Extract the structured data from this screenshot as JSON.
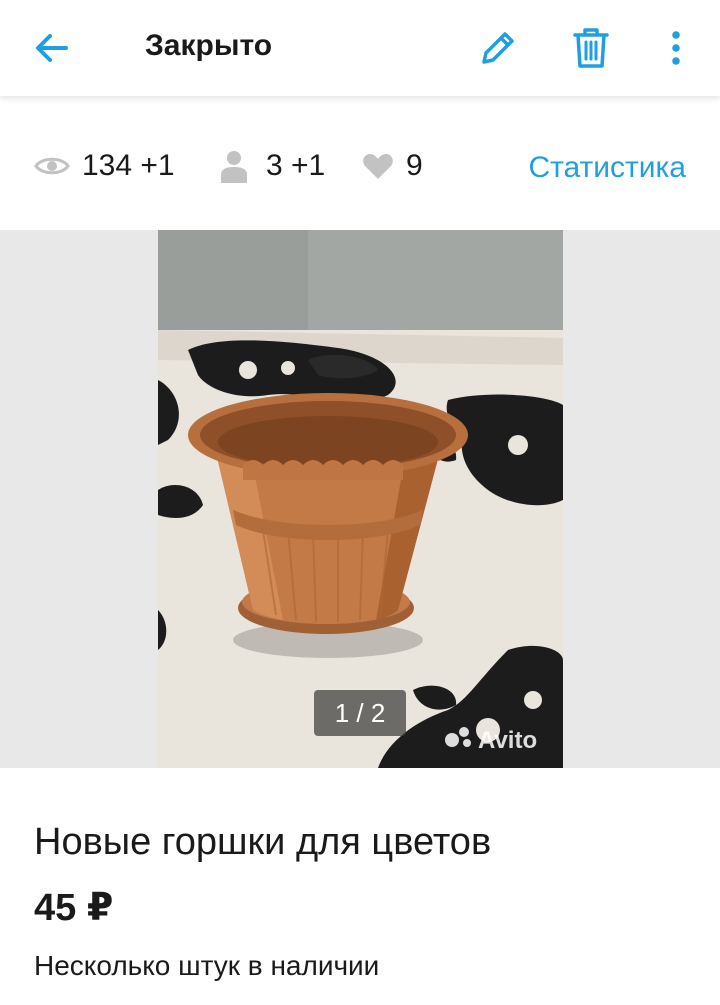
{
  "appbar": {
    "title": "Закрыто",
    "back_icon": "arrow-left-icon",
    "edit_icon": "pencil-icon",
    "delete_icon": "trash-icon",
    "more_icon": "more-vertical-icon",
    "accent_color": "#1f9fe0"
  },
  "stats": {
    "views": "134 +1",
    "contacts": "3 +1",
    "favorites": "9",
    "link_label": "Статистика",
    "views_icon": "eye-icon",
    "contacts_icon": "person-icon",
    "favorites_icon": "heart-icon"
  },
  "gallery": {
    "counter": "1 / 2",
    "current": 1,
    "total": 2,
    "watermark": "Avito"
  },
  "listing": {
    "title": "Новые горшки для цветов",
    "price": "45 ₽",
    "description": "Несколько штук в наличии"
  }
}
